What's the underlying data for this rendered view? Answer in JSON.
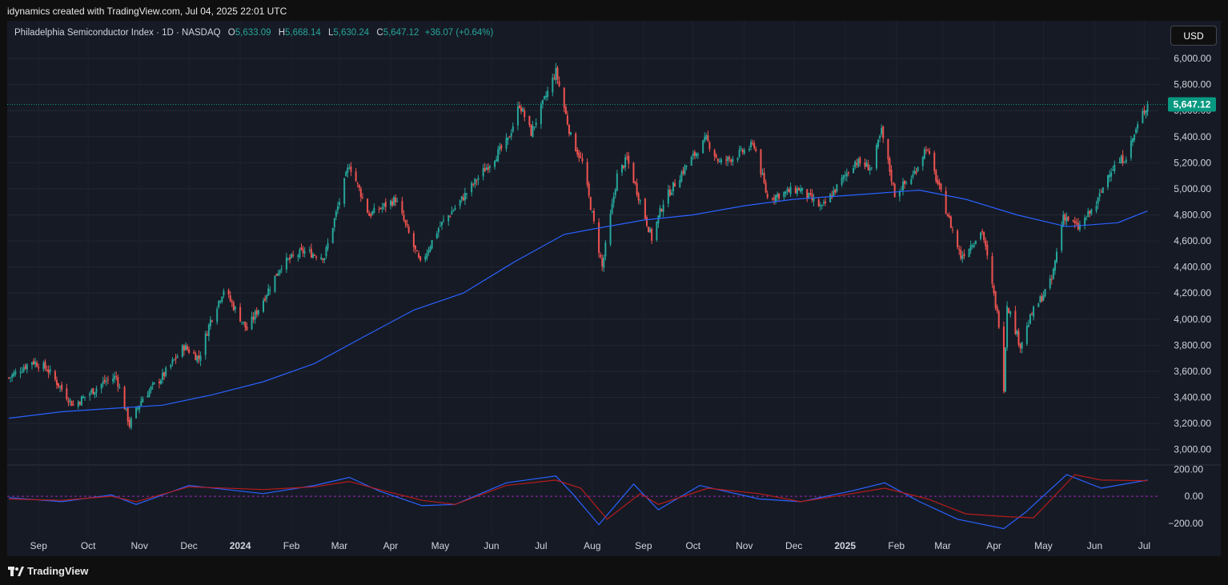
{
  "header": {
    "attribution": "idynamics created with TradingView.com, Jul 04, 2025 22:01 UTC"
  },
  "legend": {
    "symbol": "Philadelphia Semiconductor Index · 1D · NASDAQ",
    "o_label": "O",
    "o_value": "5,633.09",
    "h_label": "H",
    "h_value": "5,668.14",
    "l_label": "L",
    "l_value": "5,630.24",
    "c_label": "C",
    "c_value": "5,647.12",
    "change": "+36.07 (+0.64%)"
  },
  "currency_button": "USD",
  "last_price_tag": "5,647.12",
  "footer": {
    "brand": "TradingView"
  },
  "colors": {
    "up": "#26a69a",
    "down": "#ef5350",
    "ma": "#2962ff",
    "osc_fast": "#2962ff",
    "osc_slow": "#b71c1c",
    "price_tag": "#089981"
  },
  "chart_data": {
    "type": "candlestick",
    "title": "Philadelphia Semiconductor Index · 1D · NASDAQ",
    "y_axis": {
      "ticks": [
        "6,000.00",
        "5,800.00",
        "5,600.00",
        "5,400.00",
        "5,200.00",
        "5,000.00",
        "4,800.00",
        "4,600.00",
        "4,400.00",
        "4,200.00",
        "4,000.00",
        "3,800.00",
        "3,600.00",
        "3,400.00",
        "3,200.00",
        "3,000.00"
      ],
      "range": [
        2900,
        6080
      ]
    },
    "x_axis": {
      "ticks": [
        "Sep",
        "Oct",
        "Nov",
        "Dec",
        "2024",
        "Feb",
        "Mar",
        "Apr",
        "May",
        "Jun",
        "Jul",
        "Aug",
        "Sep",
        "Oct",
        "Nov",
        "Dec",
        "2025",
        "Feb",
        "Mar",
        "Apr",
        "May",
        "Jun",
        "Jul"
      ],
      "bold": [
        "2024",
        "2025"
      ]
    },
    "grid": true,
    "price_path": [
      [
        "2023-08-14",
        3550
      ],
      [
        "2023-08-28",
        3680
      ],
      [
        "2023-09-06",
        3620
      ],
      [
        "2023-09-22",
        3340
      ],
      [
        "2023-10-11",
        3520
      ],
      [
        "2023-10-18",
        3560
      ],
      [
        "2023-10-26",
        3190
      ],
      [
        "2023-11-03",
        3400
      ],
      [
        "2023-11-15",
        3560
      ],
      [
        "2023-11-28",
        3790
      ],
      [
        "2023-12-07",
        3700
      ],
      [
        "2023-12-14",
        3990
      ],
      [
        "2023-12-22",
        4230
      ],
      [
        "2024-01-05",
        3920
      ],
      [
        "2024-01-12",
        4080
      ],
      [
        "2024-01-26",
        4420
      ],
      [
        "2024-02-08",
        4520
      ],
      [
        "2024-02-21",
        4480
      ],
      [
        "2024-03-07",
        5190
      ],
      [
        "2024-03-19",
        4800
      ],
      [
        "2024-04-04",
        4920
      ],
      [
        "2024-04-19",
        4420
      ],
      [
        "2024-04-30",
        4700
      ],
      [
        "2024-05-14",
        4920
      ],
      [
        "2024-05-28",
        5150
      ],
      [
        "2024-06-11",
        5370
      ],
      [
        "2024-06-18",
        5650
      ],
      [
        "2024-06-25",
        5430
      ],
      [
        "2024-07-10",
        5900
      ],
      [
        "2024-07-19",
        5400
      ],
      [
        "2024-07-26",
        5200
      ],
      [
        "2024-08-07",
        4400
      ],
      [
        "2024-08-16",
        5100
      ],
      [
        "2024-08-22",
        5230
      ],
      [
        "2024-09-06",
        4620
      ],
      [
        "2024-09-13",
        4900
      ],
      [
        "2024-09-27",
        5180
      ],
      [
        "2024-10-09",
        5380
      ],
      [
        "2024-10-17",
        5200
      ],
      [
        "2024-10-25",
        5240
      ],
      [
        "2024-11-07",
        5340
      ],
      [
        "2024-11-15",
        4930
      ],
      [
        "2024-12-04",
        5000
      ],
      [
        "2024-12-18",
        4850
      ],
      [
        "2025-01-07",
        5210
      ],
      [
        "2025-01-17",
        5160
      ],
      [
        "2025-01-23",
        5440
      ],
      [
        "2025-01-31",
        4960
      ],
      [
        "2025-02-11",
        5100
      ],
      [
        "2025-02-19",
        5320
      ],
      [
        "2025-03-04",
        4800
      ],
      [
        "2025-03-12",
        4480
      ],
      [
        "2025-03-25",
        4680
      ],
      [
        "2025-04-04",
        3970
      ],
      [
        "2025-04-07",
        3480
      ],
      [
        "2025-04-09",
        4120
      ],
      [
        "2025-04-17",
        3800
      ],
      [
        "2025-04-24",
        4040
      ],
      [
        "2025-05-06",
        4300
      ],
      [
        "2025-05-13",
        4800
      ],
      [
        "2025-05-22",
        4700
      ],
      [
        "2025-06-02",
        4880
      ],
      [
        "2025-06-10",
        5140
      ],
      [
        "2025-06-20",
        5250
      ],
      [
        "2025-06-30",
        5580
      ],
      [
        "2025-07-03",
        5647.12
      ]
    ],
    "moving_average": [
      [
        "2023-08-14",
        3240
      ],
      [
        "2023-09-15",
        3290
      ],
      [
        "2023-10-15",
        3315
      ],
      [
        "2023-11-15",
        3340
      ],
      [
        "2023-12-15",
        3420
      ],
      [
        "2024-01-15",
        3520
      ],
      [
        "2024-02-15",
        3660
      ],
      [
        "2024-03-15",
        3860
      ],
      [
        "2024-04-15",
        4070
      ],
      [
        "2024-05-15",
        4200
      ],
      [
        "2024-06-15",
        4440
      ],
      [
        "2024-07-15",
        4650
      ],
      [
        "2024-08-01",
        4690
      ],
      [
        "2024-09-01",
        4760
      ],
      [
        "2024-10-01",
        4800
      ],
      [
        "2024-11-01",
        4870
      ],
      [
        "2024-12-01",
        4920
      ],
      [
        "2025-01-15",
        4960
      ],
      [
        "2025-02-15",
        4990
      ],
      [
        "2025-03-15",
        4920
      ],
      [
        "2025-04-15",
        4800
      ],
      [
        "2025-05-15",
        4710
      ],
      [
        "2025-06-15",
        4740
      ],
      [
        "2025-07-03",
        4830
      ]
    ],
    "oscillator": {
      "axis_ticks": [
        "200.00",
        "0.00",
        "−200.00"
      ],
      "range": [
        -260,
        220
      ],
      "fast": [
        [
          "2023-08-14",
          -10
        ],
        [
          "2023-09-15",
          -40
        ],
        [
          "2023-10-15",
          10
        ],
        [
          "2023-10-30",
          -60
        ],
        [
          "2023-12-01",
          80
        ],
        [
          "2024-01-15",
          20
        ],
        [
          "2024-02-15",
          80
        ],
        [
          "2024-03-07",
          140
        ],
        [
          "2024-03-25",
          40
        ],
        [
          "2024-04-20",
          -70
        ],
        [
          "2024-05-10",
          -60
        ],
        [
          "2024-06-10",
          100
        ],
        [
          "2024-07-10",
          150
        ],
        [
          "2024-07-20",
          20
        ],
        [
          "2024-08-05",
          -210
        ],
        [
          "2024-08-26",
          90
        ],
        [
          "2024-09-10",
          -100
        ],
        [
          "2024-10-05",
          80
        ],
        [
          "2024-11-10",
          -20
        ],
        [
          "2024-12-05",
          -40
        ],
        [
          "2025-01-05",
          40
        ],
        [
          "2025-01-25",
          100
        ],
        [
          "2025-02-15",
          -40
        ],
        [
          "2025-03-10",
          -170
        ],
        [
          "2025-04-07",
          -240
        ],
        [
          "2025-04-20",
          -120
        ],
        [
          "2025-05-15",
          160
        ],
        [
          "2025-06-05",
          60
        ],
        [
          "2025-07-03",
          120
        ]
      ],
      "slow": [
        [
          "2023-08-14",
          -20
        ],
        [
          "2023-09-15",
          -30
        ],
        [
          "2023-10-15",
          0
        ],
        [
          "2023-10-30",
          -40
        ],
        [
          "2023-12-01",
          70
        ],
        [
          "2024-01-15",
          50
        ],
        [
          "2024-02-15",
          70
        ],
        [
          "2024-03-07",
          110
        ],
        [
          "2024-03-25",
          50
        ],
        [
          "2024-04-20",
          -30
        ],
        [
          "2024-05-10",
          -60
        ],
        [
          "2024-06-10",
          80
        ],
        [
          "2024-07-10",
          120
        ],
        [
          "2024-07-25",
          60
        ],
        [
          "2024-08-10",
          -170
        ],
        [
          "2024-08-30",
          20
        ],
        [
          "2024-09-10",
          -60
        ],
        [
          "2024-10-10",
          60
        ],
        [
          "2024-11-10",
          20
        ],
        [
          "2024-12-05",
          -40
        ],
        [
          "2025-01-05",
          20
        ],
        [
          "2025-01-25",
          60
        ],
        [
          "2025-02-20",
          -20
        ],
        [
          "2025-03-15",
          -130
        ],
        [
          "2025-04-07",
          -150
        ],
        [
          "2025-04-25",
          -160
        ],
        [
          "2025-05-20",
          160
        ],
        [
          "2025-06-05",
          120
        ],
        [
          "2025-07-03",
          115
        ]
      ]
    }
  }
}
